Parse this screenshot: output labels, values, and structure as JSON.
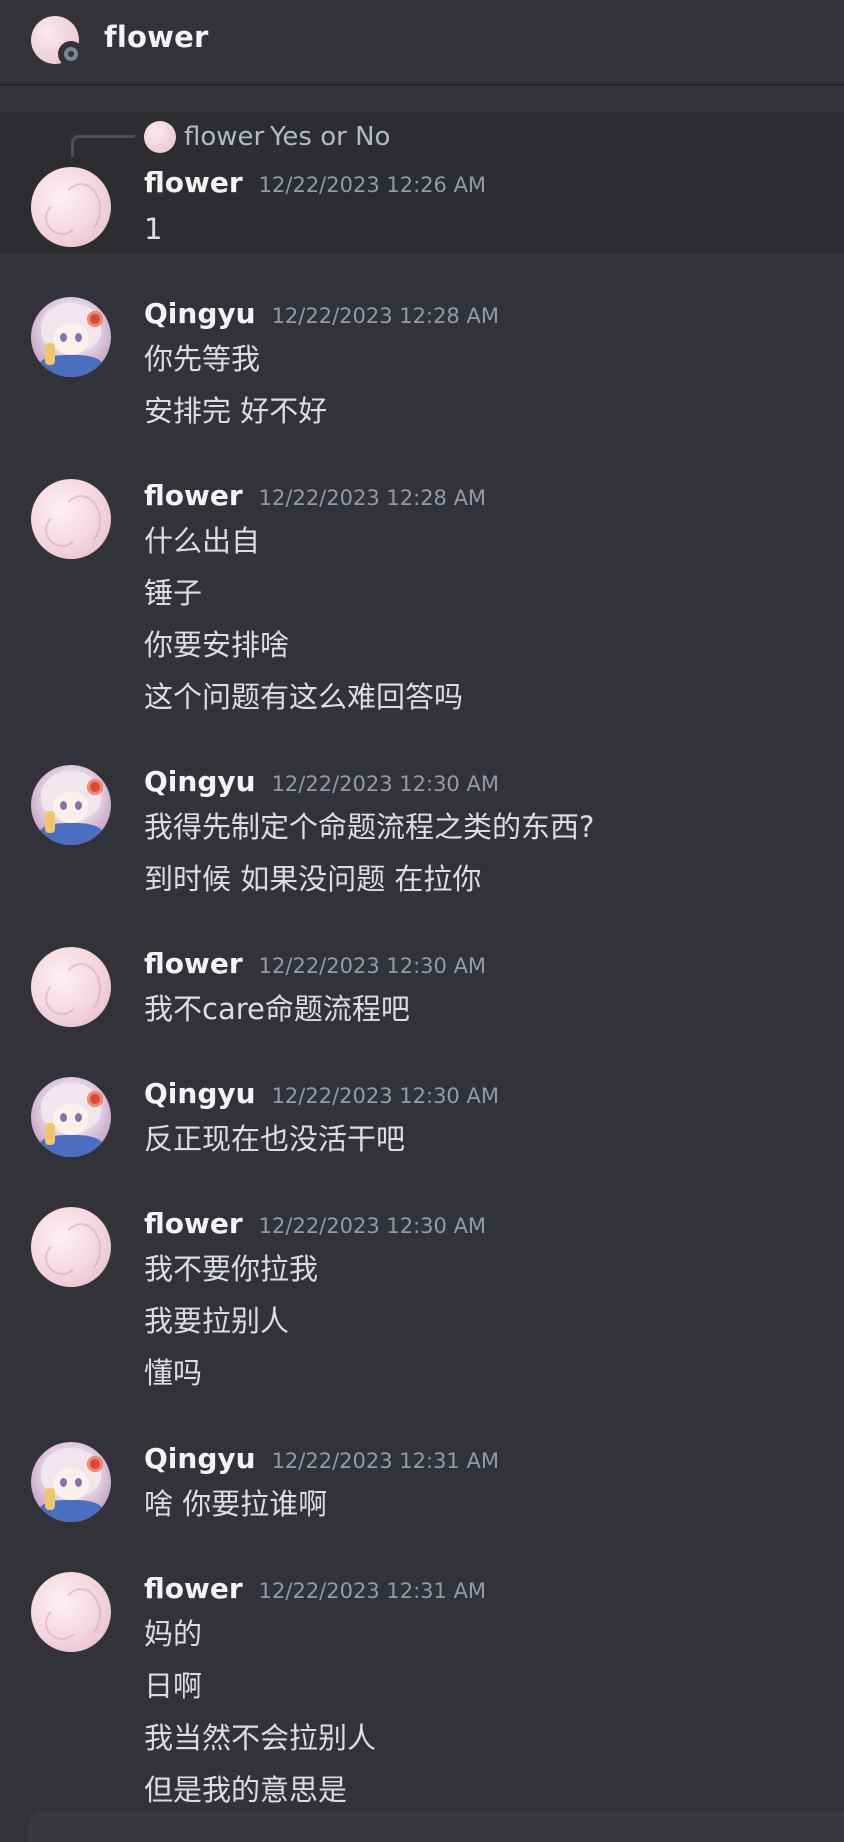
{
  "channel": {
    "title": "flower"
  },
  "reply": {
    "author": "flower",
    "text": "Yes or No"
  },
  "messages": [
    {
      "author": "flower",
      "avatar": "flower",
      "timestamp": "12/22/2023 12:26 AM",
      "lines": [
        "1"
      ]
    },
    {
      "author": "Qingyu",
      "avatar": "qingyu",
      "timestamp": "12/22/2023 12:28 AM",
      "lines": [
        "你先等我",
        "安排完 好不好"
      ]
    },
    {
      "author": "flower",
      "avatar": "flower",
      "timestamp": "12/22/2023 12:28 AM",
      "lines": [
        "什么出自",
        "锤子",
        "你要安排啥",
        "这个问题有这么难回答吗"
      ]
    },
    {
      "author": "Qingyu",
      "avatar": "qingyu",
      "timestamp": "12/22/2023 12:30 AM",
      "lines": [
        "我得先制定个命题流程之类的东西?",
        "到时候 如果没问题 在拉你"
      ]
    },
    {
      "author": "flower",
      "avatar": "flower",
      "timestamp": "12/22/2023 12:30 AM",
      "lines": [
        "我不care命题流程吧"
      ]
    },
    {
      "author": "Qingyu",
      "avatar": "qingyu",
      "timestamp": "12/22/2023 12:30 AM",
      "lines": [
        "反正现在也没活干吧"
      ]
    },
    {
      "author": "flower",
      "avatar": "flower",
      "timestamp": "12/22/2023 12:30 AM",
      "lines": [
        "我不要你拉我",
        "我要拉别人",
        "懂吗"
      ]
    },
    {
      "author": "Qingyu",
      "avatar": "qingyu",
      "timestamp": "12/22/2023 12:31 AM",
      "lines": [
        "啥 你要拉谁啊"
      ]
    },
    {
      "author": "flower",
      "avatar": "flower",
      "timestamp": "12/22/2023 12:31 AM",
      "lines": [
        "妈的",
        "日啊",
        "我当然不会拉别人",
        "但是我的意思是"
      ]
    }
  ]
}
